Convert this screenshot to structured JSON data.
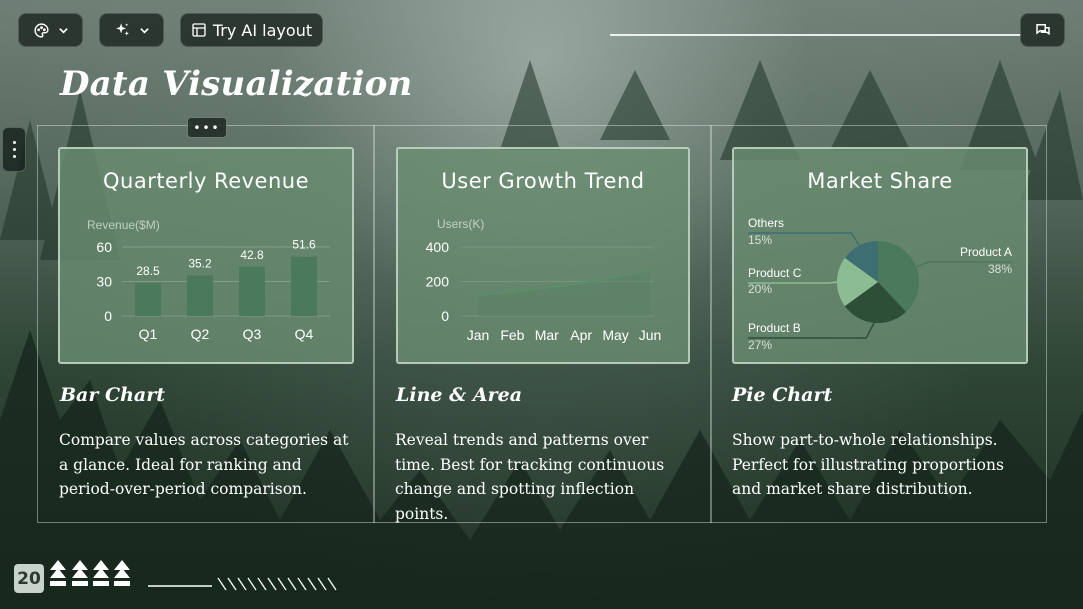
{
  "toolbar": {
    "theme_icon": "palette-icon",
    "ai_icon": "sparkle-icon",
    "layout_icon": "layout-icon",
    "try_ai_layout_label": "Try AI layout",
    "comment_icon": "comment-icon"
  },
  "page": {
    "title": "Data Visualization",
    "number": "20"
  },
  "sections": [
    {
      "heading": "Bar Chart",
      "description": "Compare values across categories at a glance. Ideal for ranking and period-over-period comparison."
    },
    {
      "heading": "Line & Area",
      "description": "Reveal trends and patterns over time. Best for tracking continuous change and spotting inflection points."
    },
    {
      "heading": "Pie Chart",
      "description": "Show part-to-whole relationships. Perfect for illustrating proportions and market share distribution."
    }
  ],
  "colors": {
    "card_bg": "#6a8c70",
    "bar": "#4a7a5a",
    "line": "#5d8d68",
    "pie_a": "#4a7a5a",
    "pie_b": "#2d4f38",
    "pie_c": "#8cbd92",
    "pie_others": "#3d6e72"
  },
  "chart_data": [
    {
      "type": "bar",
      "title": "Quarterly Revenue",
      "ylabel": "Revenue($M)",
      "categories": [
        "Q1",
        "Q2",
        "Q3",
        "Q4"
      ],
      "values": [
        28.5,
        35.2,
        42.8,
        51.6
      ],
      "data_labels": [
        "28.5",
        "35.2",
        "42.8",
        "51.6"
      ],
      "yticks": [
        "0",
        "30",
        "60"
      ],
      "ylim": [
        0,
        60
      ],
      "grid": true
    },
    {
      "type": "area",
      "title": "User Growth Trend",
      "ylabel": "Users(K)",
      "categories": [
        "Jan",
        "Feb",
        "Mar",
        "Apr",
        "May",
        "Jun"
      ],
      "values": [
        120,
        140,
        165,
        190,
        225,
        265
      ],
      "yticks": [
        "0",
        "200",
        "400"
      ],
      "ylim": [
        0,
        400
      ],
      "grid": true
    },
    {
      "type": "pie",
      "title": "Market Share",
      "slices": [
        {
          "name": "Product A",
          "label": "38%",
          "value": 38
        },
        {
          "name": "Product B",
          "label": "27%",
          "value": 27
        },
        {
          "name": "Product C",
          "label": "20%",
          "value": 20
        },
        {
          "name": "Others",
          "label": "15%",
          "value": 15
        }
      ]
    }
  ]
}
